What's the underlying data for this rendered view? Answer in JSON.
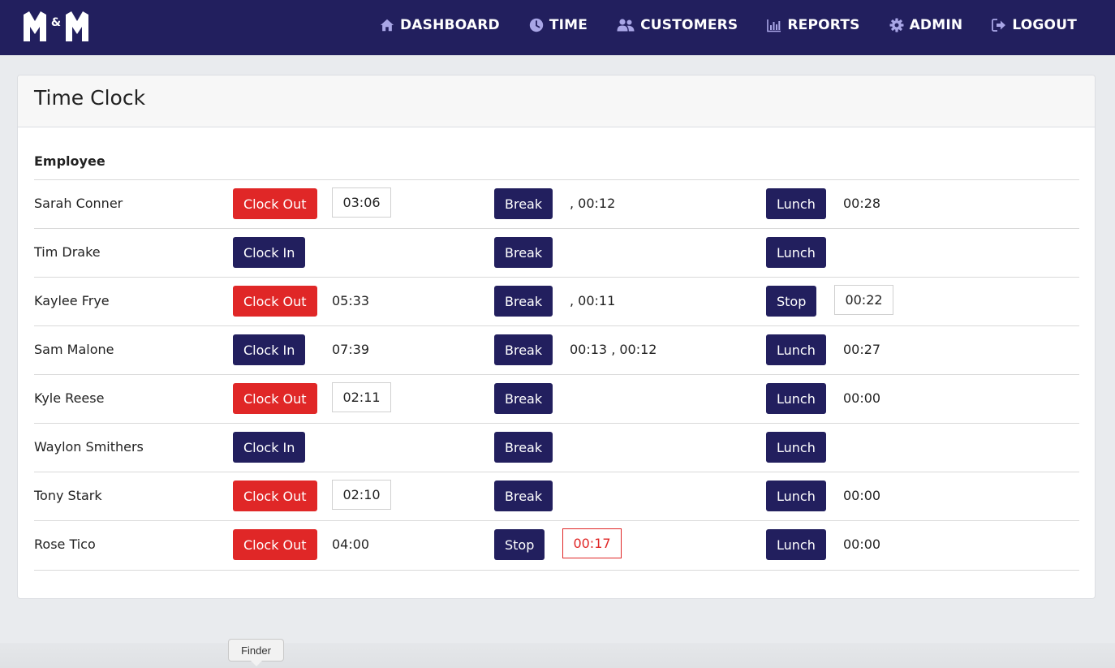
{
  "brand": {
    "logo_text": "M&M"
  },
  "nav": [
    {
      "label": "DASHBOARD",
      "icon": "home-icon"
    },
    {
      "label": "TIME",
      "icon": "clock-icon"
    },
    {
      "label": "CUSTOMERS",
      "icon": "users-icon"
    },
    {
      "label": "REPORTS",
      "icon": "bar-chart-icon"
    },
    {
      "label": "ADMIN",
      "icon": "gear-icon"
    },
    {
      "label": "LOGOUT",
      "icon": "logout-icon"
    }
  ],
  "page": {
    "title": "Time Clock",
    "column_header": "Employee"
  },
  "colors": {
    "navy": "#221f5e",
    "red": "#e02727"
  },
  "employees": [
    {
      "name": "Sarah Conner",
      "clock": {
        "label": "Clock Out",
        "style": "red",
        "time": "03:06",
        "boxed": true
      },
      "break": {
        "label": "Break",
        "time": ", 00:12",
        "boxed": false
      },
      "lunch": {
        "label": "Lunch",
        "time": "00:28",
        "boxed": false
      }
    },
    {
      "name": "Tim Drake",
      "clock": {
        "label": "Clock In",
        "style": "navy",
        "time": "",
        "boxed": false
      },
      "break": {
        "label": "Break",
        "time": "",
        "boxed": false
      },
      "lunch": {
        "label": "Lunch",
        "time": "",
        "boxed": false
      }
    },
    {
      "name": "Kaylee Frye",
      "clock": {
        "label": "Clock Out",
        "style": "red",
        "time": "05:33",
        "boxed": false
      },
      "break": {
        "label": "Break",
        "time": ", 00:11",
        "boxed": false
      },
      "lunch": {
        "label": "Stop",
        "time": "00:22",
        "boxed": true
      }
    },
    {
      "name": "Sam Malone",
      "clock": {
        "label": "Clock In",
        "style": "navy",
        "time": "07:39",
        "boxed": false
      },
      "break": {
        "label": "Break",
        "time": "00:13 , 00:12",
        "boxed": false
      },
      "lunch": {
        "label": "Lunch",
        "time": "00:27",
        "boxed": false
      }
    },
    {
      "name": "Kyle Reese",
      "clock": {
        "label": "Clock Out",
        "style": "red",
        "time": "02:11",
        "boxed": true
      },
      "break": {
        "label": "Break",
        "time": "",
        "boxed": false
      },
      "lunch": {
        "label": "Lunch",
        "time": "00:00",
        "boxed": false
      }
    },
    {
      "name": "Waylon Smithers",
      "clock": {
        "label": "Clock In",
        "style": "navy",
        "time": "",
        "boxed": false
      },
      "break": {
        "label": "Break",
        "time": "",
        "boxed": false
      },
      "lunch": {
        "label": "Lunch",
        "time": "",
        "boxed": false
      }
    },
    {
      "name": "Tony Stark",
      "clock": {
        "label": "Clock Out",
        "style": "red",
        "time": "02:10",
        "boxed": true
      },
      "break": {
        "label": "Break",
        "time": "",
        "boxed": false
      },
      "lunch": {
        "label": "Lunch",
        "time": "00:00",
        "boxed": false
      }
    },
    {
      "name": "Rose Tico",
      "clock": {
        "label": "Clock Out",
        "style": "red",
        "time": "04:00",
        "boxed": false
      },
      "break": {
        "label": "Stop",
        "time": "00:17",
        "boxed": true,
        "alert": true
      },
      "lunch": {
        "label": "Lunch",
        "time": "00:00",
        "boxed": false
      }
    }
  ],
  "dock": {
    "tooltip": "Finder"
  }
}
